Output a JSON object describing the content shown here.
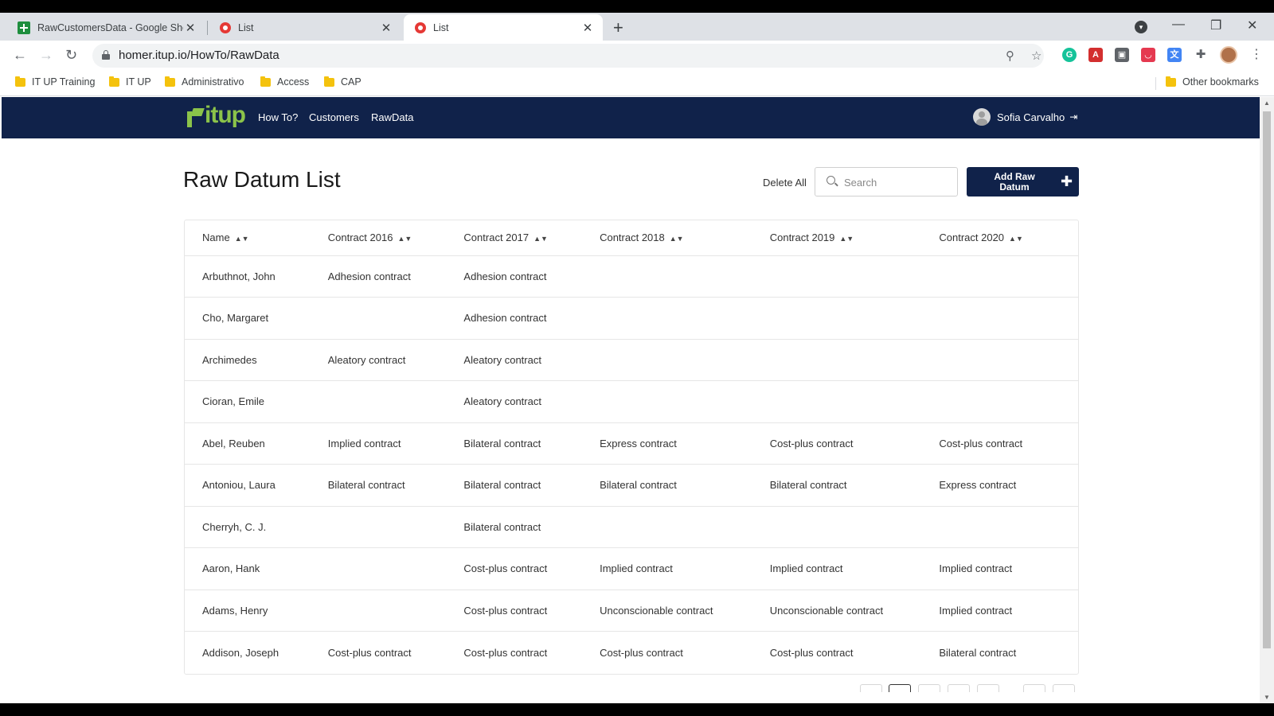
{
  "browser": {
    "tabs": [
      {
        "title": "RawCustomersData - Google Sheets",
        "active": false
      },
      {
        "title": "List",
        "active": false
      },
      {
        "title": "List",
        "active": true
      }
    ],
    "url": "homer.itup.io/HowTo/RawData",
    "bookmarks": [
      "IT UP Training",
      "IT UP",
      "Administrativo",
      "Access",
      "CAP"
    ],
    "other_bookmarks": "Other bookmarks"
  },
  "app": {
    "brand": "itup",
    "nav": [
      "How To?",
      "Customers",
      "RawData"
    ],
    "user_name": "Sofia Carvalho"
  },
  "page": {
    "title": "Raw Datum List",
    "delete_all": "Delete All",
    "search_placeholder": "Search",
    "add_button": "Add Raw Datum",
    "columns": [
      "Name",
      "Contract 2016",
      "Contract 2017",
      "Contract 2018",
      "Contract 2019",
      "Contract 2020"
    ],
    "rows": [
      [
        "Arbuthnot, John",
        "Adhesion contract",
        "Adhesion contract",
        "",
        "",
        ""
      ],
      [
        "Cho, Margaret",
        "",
        "Adhesion contract",
        "",
        "",
        ""
      ],
      [
        "Archimedes",
        "Aleatory contract",
        "Aleatory contract",
        "",
        "",
        ""
      ],
      [
        "Cioran, Emile",
        "",
        "Aleatory contract",
        "",
        "",
        ""
      ],
      [
        "Abel, Reuben",
        "Implied contract",
        "Bilateral contract",
        "Express contract",
        "Cost-plus contract",
        "Cost-plus contract"
      ],
      [
        "Antoniou, Laura",
        "Bilateral contract",
        "Bilateral contract",
        "Bilateral contract",
        "Bilateral contract",
        "Express contract"
      ],
      [
        "Cherryh, C. J.",
        "",
        "Bilateral contract",
        "",
        "",
        ""
      ],
      [
        "Aaron, Hank",
        "",
        "Cost-plus contract",
        "Implied contract",
        "Implied contract",
        "Implied contract"
      ],
      [
        "Adams, Henry",
        "",
        "Cost-plus contract",
        "Unconscionable contract",
        "Unconscionable contract",
        "Implied contract"
      ],
      [
        "Addison, Joseph",
        "Cost-plus contract",
        "Cost-plus contract",
        "Cost-plus contract",
        "Cost-plus contract",
        "Bilateral contract"
      ]
    ]
  },
  "colors": {
    "appbar": "#10224a",
    "brand_green": "#8bc34a"
  }
}
